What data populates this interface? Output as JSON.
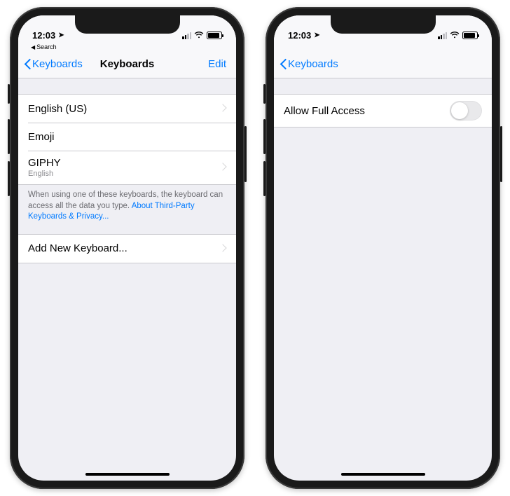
{
  "left": {
    "status": {
      "time": "12:03",
      "breadcrumb": "Search"
    },
    "nav": {
      "back": "Keyboards",
      "title": "Keyboards",
      "edit": "Edit"
    },
    "keyboards": [
      {
        "label": "English (US)",
        "sub": "",
        "disclosure": true
      },
      {
        "label": "Emoji",
        "sub": "",
        "disclosure": false
      },
      {
        "label": "GIPHY",
        "sub": "English",
        "disclosure": true
      }
    ],
    "footer": {
      "text": "When using one of these keyboards, the keyboard can access all the data you type. ",
      "link": "About Third-Party Keyboards & Privacy..."
    },
    "add": {
      "label": "Add New Keyboard..."
    }
  },
  "right": {
    "status": {
      "time": "12:03",
      "breadcrumb": ""
    },
    "nav": {
      "back": "Keyboards",
      "title": "",
      "edit": ""
    },
    "row": {
      "label": "Allow Full Access",
      "toggle_on": false
    }
  }
}
